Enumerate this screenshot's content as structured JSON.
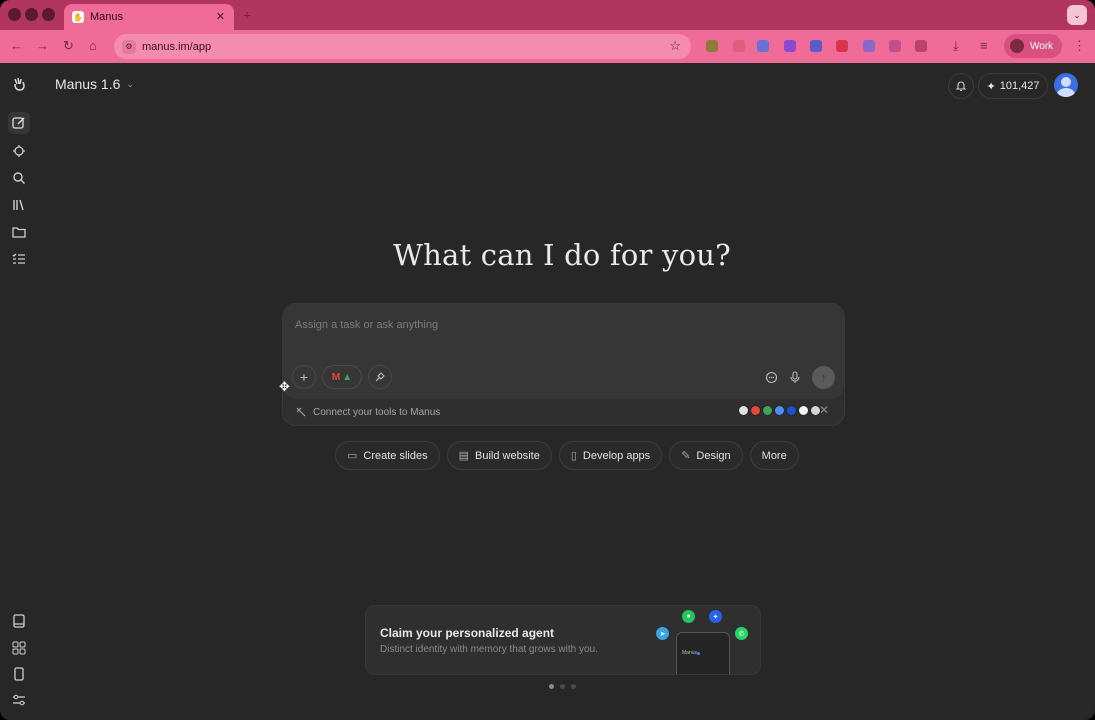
{
  "browser": {
    "tab_title": "Manus",
    "tab_favicon": "manus-hand-icon",
    "url": "manus.im/app",
    "profile_label": "Work",
    "accent_color": "#ef6b98",
    "new_tab_symbol": "+",
    "tab_close_symbol": "✕",
    "window_menu_symbol": "⌄"
  },
  "app": {
    "model_label": "Manus 1.6",
    "credits": "101,427",
    "heading": "What can I do for you?",
    "composer": {
      "placeholder": "Assign a task or ask anything",
      "add_symbol": "+",
      "connect_text": "Connect your tools to Manus",
      "close_symbol": "✕"
    },
    "quick_actions": [
      {
        "label": "Create slides",
        "icon": "slides-icon"
      },
      {
        "label": "Build website",
        "icon": "website-icon"
      },
      {
        "label": "Develop apps",
        "icon": "phone-icon"
      },
      {
        "label": "Design",
        "icon": "design-icon"
      },
      {
        "label": "More",
        "icon": ""
      }
    ],
    "promo": {
      "title": "Claim your personalized agent",
      "subtitle": "Distinct identity with memory that grows with you.",
      "phone_label": "Manus"
    },
    "carousel": {
      "count": 3,
      "active": 1
    }
  },
  "sidebar": {
    "top_icons": [
      "manus-logo-icon",
      "new-task-icon",
      "agents-icon",
      "search-icon",
      "library-icon",
      "folder-icon",
      "tasks-list-icon"
    ],
    "bottom_icons": [
      "book-icon",
      "apps-grid-icon",
      "mobile-icon",
      "settings-sliders-icon"
    ]
  },
  "colors": {
    "background": "#272727",
    "composer": "#363636",
    "text": "#e9e9e9",
    "muted": "#7c7c7c"
  }
}
